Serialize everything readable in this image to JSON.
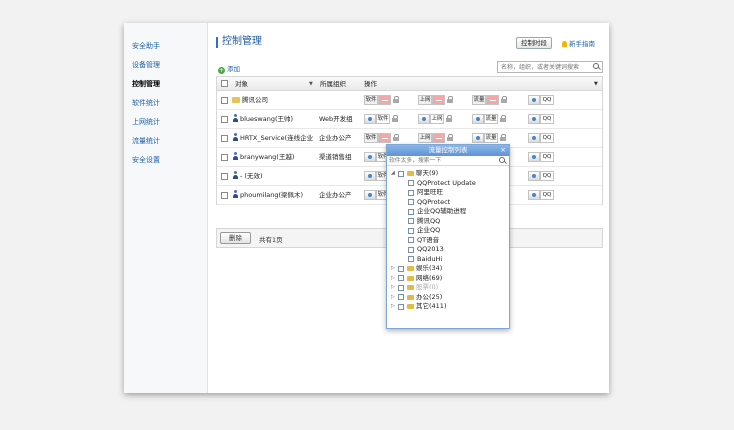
{
  "sidebar": {
    "items": [
      {
        "label": "安全助手"
      },
      {
        "label": "设备管理"
      },
      {
        "label": "控制管理"
      },
      {
        "label": "软件统计"
      },
      {
        "label": "上网统计"
      },
      {
        "label": "流量统计"
      },
      {
        "label": "安全设置"
      }
    ],
    "active_index": 2
  },
  "header": {
    "title": "控制管理",
    "control_button": "控制时段",
    "guide_link": "新手指南"
  },
  "toolbar": {
    "add_label": "添加",
    "search_placeholder": "名称，组织，或者关键词搜索"
  },
  "table": {
    "columns": {
      "object": "对象",
      "org": "所属组织",
      "action": "操作"
    },
    "rows": [
      {
        "name": "腾讯公司",
        "org": "",
        "type": "folder",
        "controls": [
          {
            "label": "软件",
            "state": "off"
          },
          {
            "label": "上网",
            "state": "off"
          },
          {
            "label": "流量",
            "state": "off"
          },
          {
            "label": "QQ",
            "state": "on"
          }
        ]
      },
      {
        "name": "blueswang(王帅)",
        "org": "Web开发组",
        "type": "user",
        "controls": [
          {
            "label": "软件",
            "state": "on"
          },
          {
            "label": "上网",
            "state": "on"
          },
          {
            "label": "流量",
            "state": "on"
          },
          {
            "label": "QQ",
            "state": "on"
          }
        ]
      },
      {
        "name": "HRTX_Service(连线企业",
        "org": "企业办公产",
        "type": "user",
        "controls": [
          {
            "label": "软件",
            "state": "off"
          },
          {
            "label": "上网",
            "state": "off"
          },
          {
            "label": "流量",
            "state": "on"
          },
          {
            "label": "QQ",
            "state": "on"
          }
        ]
      },
      {
        "name": "branywang(王越)",
        "org": "渠道销售组",
        "type": "user",
        "controls": [
          {
            "label": "软件",
            "state": "on"
          },
          {
            "label": "",
            "state": "on"
          },
          {
            "label": "",
            "state": "on"
          },
          {
            "label": "QQ",
            "state": "on"
          }
        ]
      },
      {
        "name": "- (无效)",
        "org": "",
        "type": "user",
        "controls": [
          {
            "label": "软件",
            "state": "on"
          },
          {
            "label": "",
            "state": "on"
          },
          {
            "label": "",
            "state": "on"
          },
          {
            "label": "QQ",
            "state": "on"
          }
        ]
      },
      {
        "name": "phoumilang(梁佩木)",
        "org": "企业办公产",
        "type": "user",
        "controls": [
          {
            "label": "软件",
            "state": "on"
          },
          {
            "label": "",
            "state": "on"
          },
          {
            "label": "",
            "state": "on"
          },
          {
            "label": "QQ",
            "state": "on"
          }
        ]
      }
    ],
    "delete_button": "删除",
    "total_text": "共有1页"
  },
  "popup": {
    "title": "流量控制列表",
    "close": "×",
    "search_placeholder": "软件太多，搜索一下",
    "tree": [
      {
        "label": "聊天(9)",
        "level": 0,
        "expanded": true,
        "folder": true
      },
      {
        "label": "QQProtect Update",
        "level": 1
      },
      {
        "label": "阿里旺旺",
        "level": 1
      },
      {
        "label": "QQProtect",
        "level": 1
      },
      {
        "label": "企业QQ辅助进程",
        "level": 1
      },
      {
        "label": "腾讯QQ",
        "level": 1
      },
      {
        "label": "企业QQ",
        "level": 1
      },
      {
        "label": "QT语音",
        "level": 1
      },
      {
        "label": "QQ2013",
        "level": 1
      },
      {
        "label": "BaiduHi",
        "level": 1
      },
      {
        "label": "娱乐(34)",
        "level": 0,
        "expanded": false,
        "folder": true
      },
      {
        "label": "网络(69)",
        "level": 0,
        "expanded": false,
        "folder": true
      },
      {
        "label": "股票(0)",
        "level": 0,
        "expanded": false,
        "folder": true,
        "dim": true
      },
      {
        "label": "办公(25)",
        "level": 0,
        "expanded": false,
        "folder": true
      },
      {
        "label": "其它(411)",
        "level": 0,
        "expanded": false,
        "folder": true
      }
    ]
  }
}
